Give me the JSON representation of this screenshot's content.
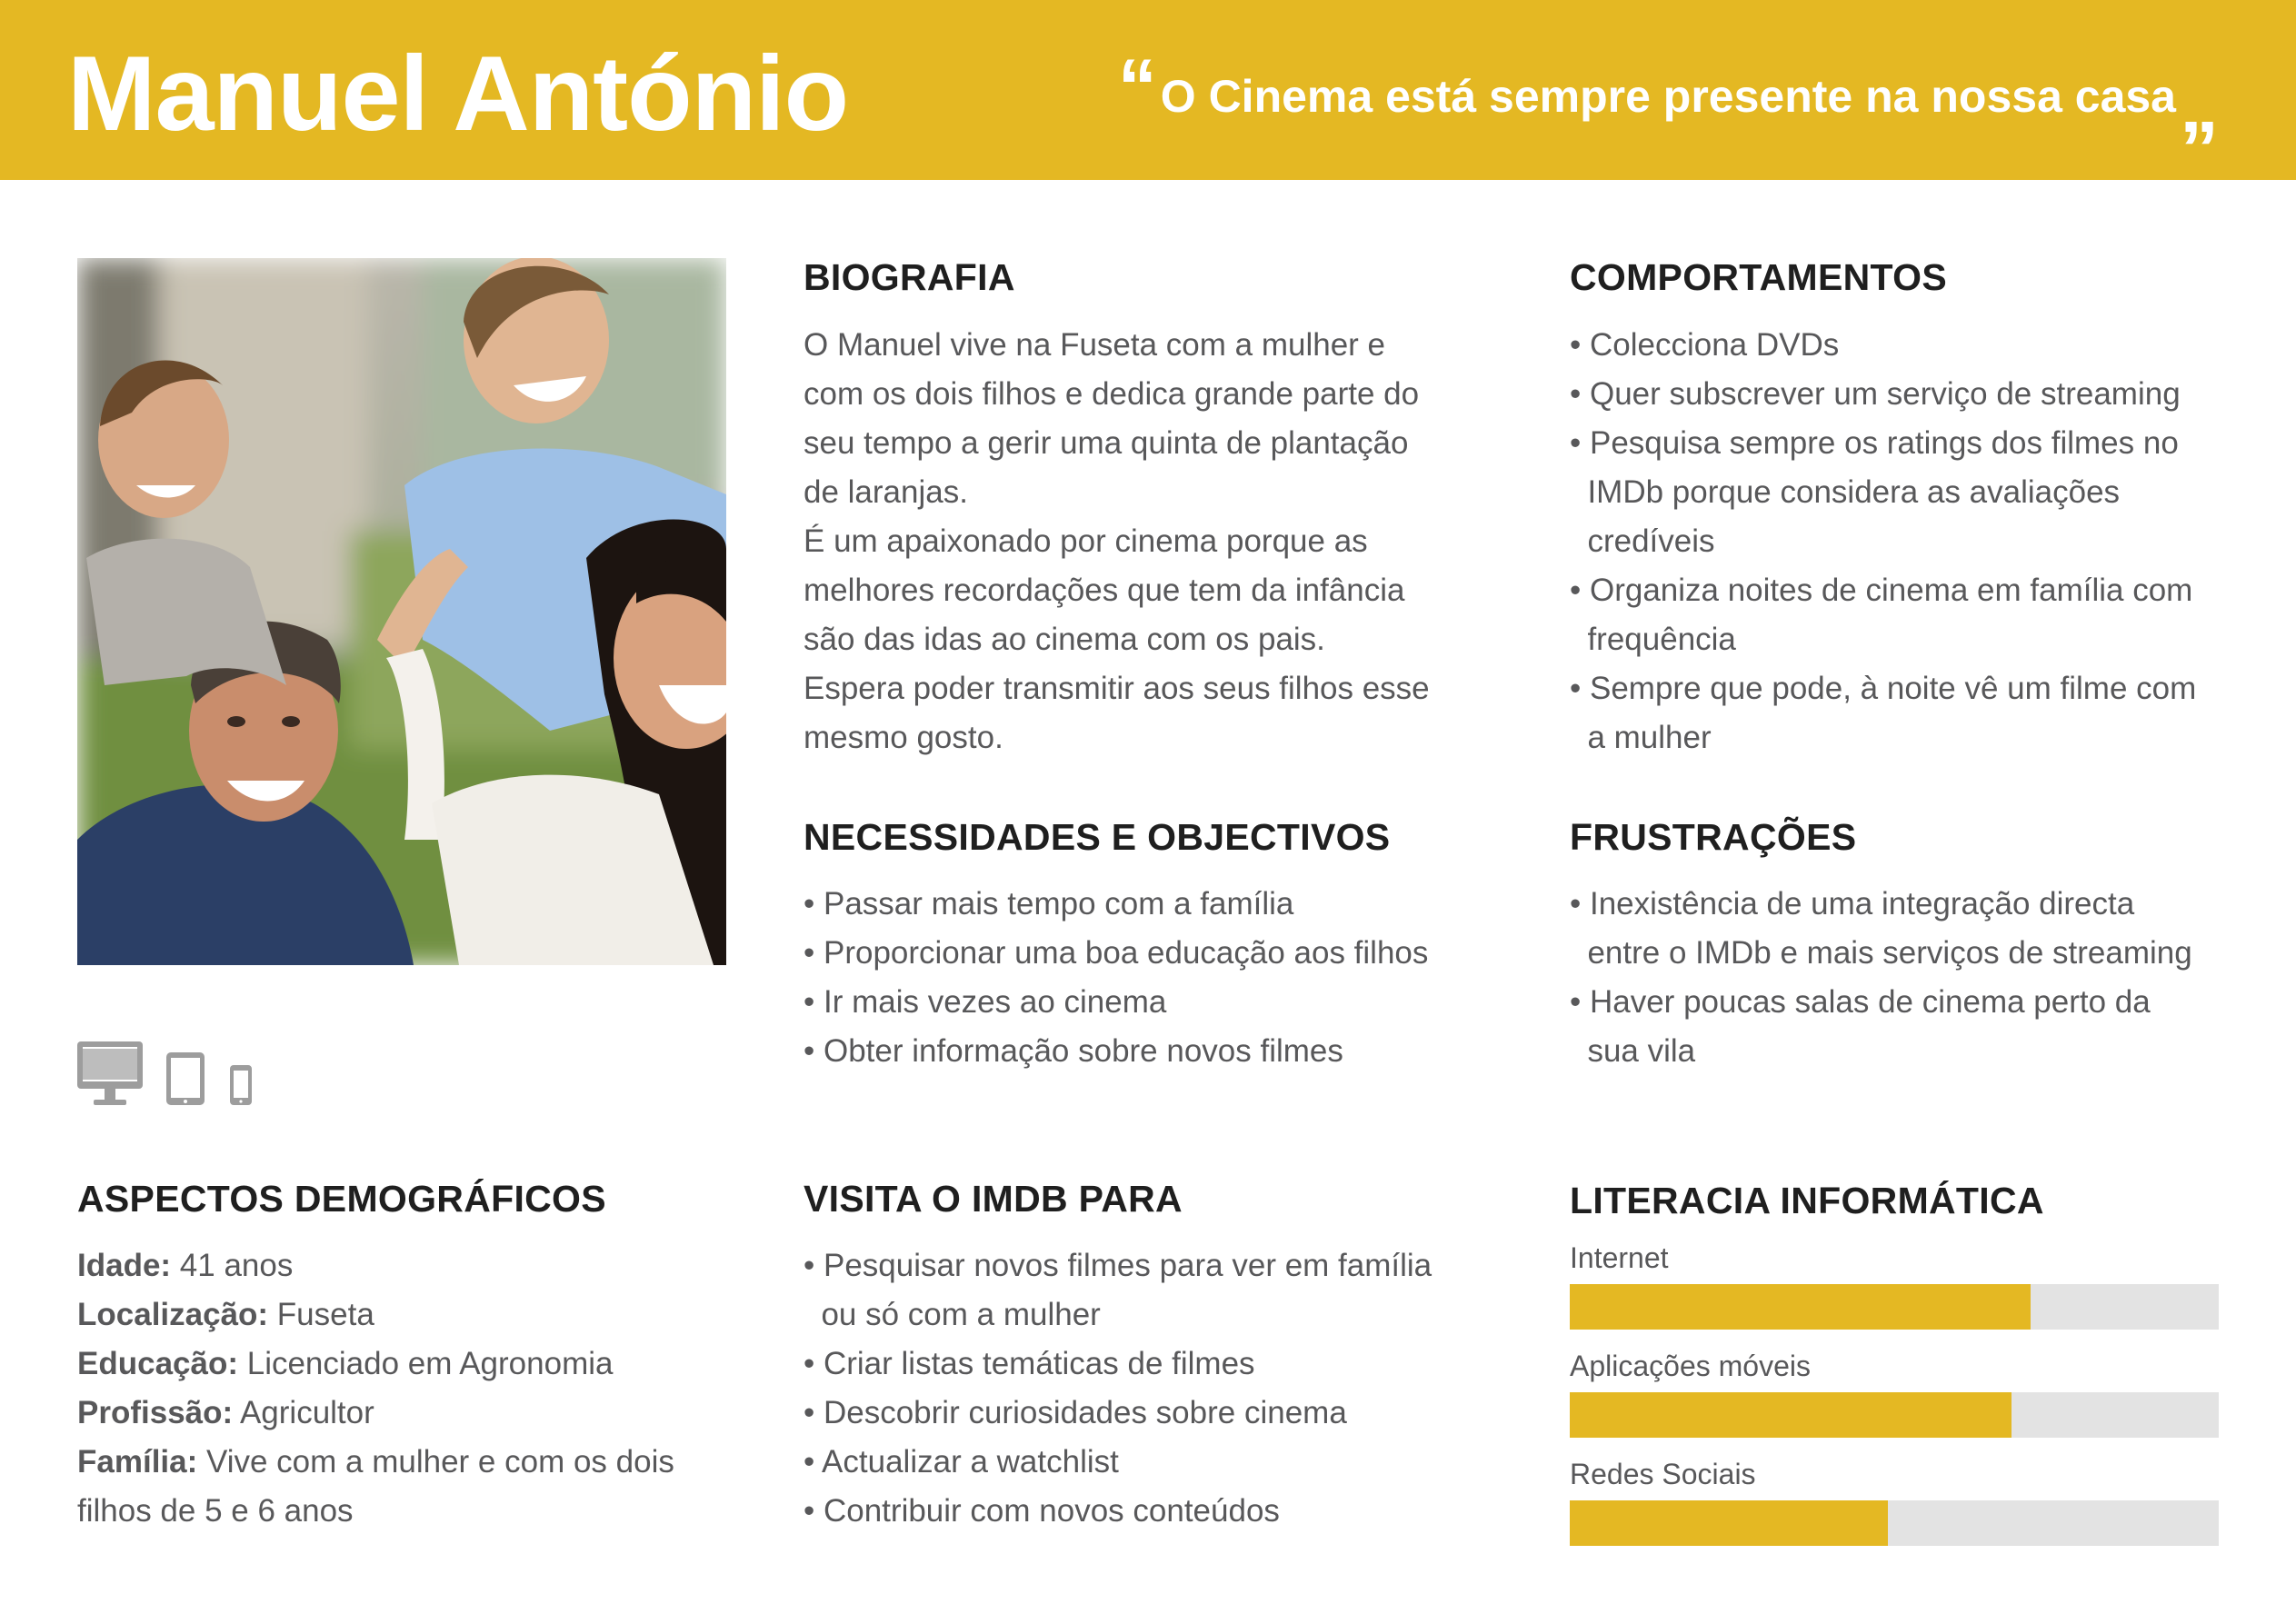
{
  "header": {
    "name": "Manuel António",
    "quote_open": "“",
    "quote": "O Cinema está sempre presente na nossa casa",
    "quote_close": "„"
  },
  "colors": {
    "accent": "#E4B823",
    "track": "#E3E3E3",
    "text": "#58585a",
    "heading": "#1f1f1f"
  },
  "photo": {
    "icon": "family-photo"
  },
  "devices": [
    "desktop-icon",
    "tablet-icon",
    "smartphone-icon"
  ],
  "demographics": {
    "title": "ASPECTOS DEMOGRÁFICOS",
    "rows": [
      {
        "label": "Idade:",
        "value": " 41 anos"
      },
      {
        "label": "Localização:",
        "value": " Fuseta"
      },
      {
        "label": "Educação:",
        "value": " Licenciado em Agronomia"
      },
      {
        "label": "Profissão:",
        "value": " Agricultor"
      },
      {
        "label": "Família:",
        "value": " Vive com a mulher e com os dois"
      }
    ],
    "continuation": "filhos de 5 e 6 anos"
  },
  "bio": {
    "title": "BIOGRAFIA",
    "lines": [
      "O Manuel vive na Fuseta com a mulher e",
      "com os dois filhos e dedica grande parte do",
      "seu tempo a gerir uma quinta de plantação",
      "de laranjas.",
      "É um apaixonado por cinema porque as",
      "melhores recordações que tem da infância",
      "são das idas ao cinema com os pais.",
      "Espera poder transmitir aos seus filhos esse",
      "mesmo gosto."
    ]
  },
  "needs": {
    "title": "NECESSIDADES E OBJECTIVOS",
    "lines": [
      "• Passar mais tempo com a família",
      "• Proporcionar uma boa educação aos filhos",
      "• Ir mais vezes ao cinema",
      "• Obter informação sobre novos filmes"
    ]
  },
  "imdb": {
    "title": "VISITA O IMDB PARA",
    "lines": [
      "• Pesquisar novos filmes para ver em família",
      "  ou só com a mulher",
      "• Criar listas temáticas de filmes",
      "• Descobrir curiosidades sobre cinema",
      "• Actualizar a watchlist",
      "• Contribuir com novos conteúdos"
    ]
  },
  "behaviours": {
    "title": "COMPORTAMENTOS",
    "lines": [
      "• Colecciona DVDs",
      "• Quer subscrever um serviço de streaming",
      "• Pesquisa sempre os ratings dos filmes no",
      "  IMDb porque considera as avaliações",
      "  credíveis",
      "• Organiza noites de cinema em família com",
      "  frequência",
      "• Sempre que pode, à noite vê um filme com",
      "  a mulher"
    ]
  },
  "frustrations": {
    "title": "FRUSTRAÇÕES",
    "lines": [
      "• Inexistência de uma integração directa",
      "  entre o IMDb e mais serviços de streaming",
      "• Haver poucas salas de cinema perto da",
      "  sua vila"
    ]
  },
  "literacy": {
    "title": "LITERACIA INFORMÁTICA",
    "items": [
      {
        "label": "Internet",
        "level": 0.71
      },
      {
        "label": "Aplicações móveis",
        "level": 0.68
      },
      {
        "label": "Redes Sociais",
        "level": 0.49
      }
    ]
  }
}
